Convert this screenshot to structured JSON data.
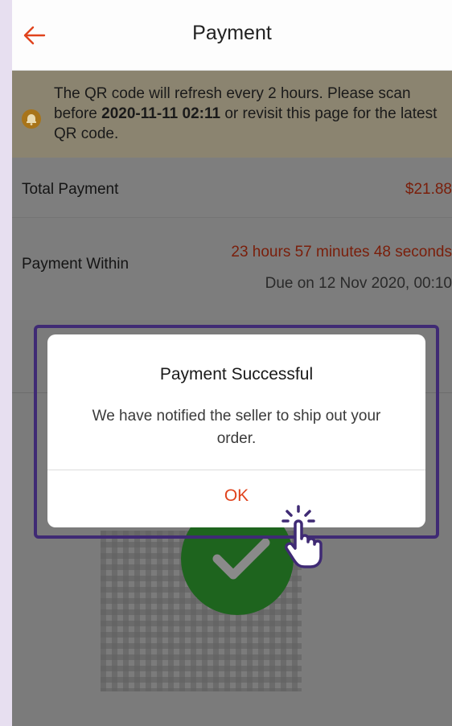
{
  "header": {
    "title": "Payment",
    "back_icon": "arrow-left-icon"
  },
  "notice": {
    "icon": "bell-icon",
    "text_part1": "The QR code will refresh every 2 hours. Please scan before ",
    "deadline": "2020-11-11 02:11",
    "text_part2": " or revisit this page for the latest QR code."
  },
  "payment": {
    "total_label": "Total Payment",
    "total_amount": "$21.88",
    "within_label": "Payment Within",
    "countdown": "23 hours 57 minutes 48 seconds",
    "due": "Due on 12 Nov 2020, 00:10"
  },
  "dialog": {
    "title": "Payment Successful",
    "message": "We have notified the seller to ship out your order.",
    "ok_label": "OK"
  },
  "colors": {
    "accent": "#e0431d",
    "amount": "#7a1e0a",
    "highlight": "#3f2a74",
    "success": "#1e641e"
  }
}
